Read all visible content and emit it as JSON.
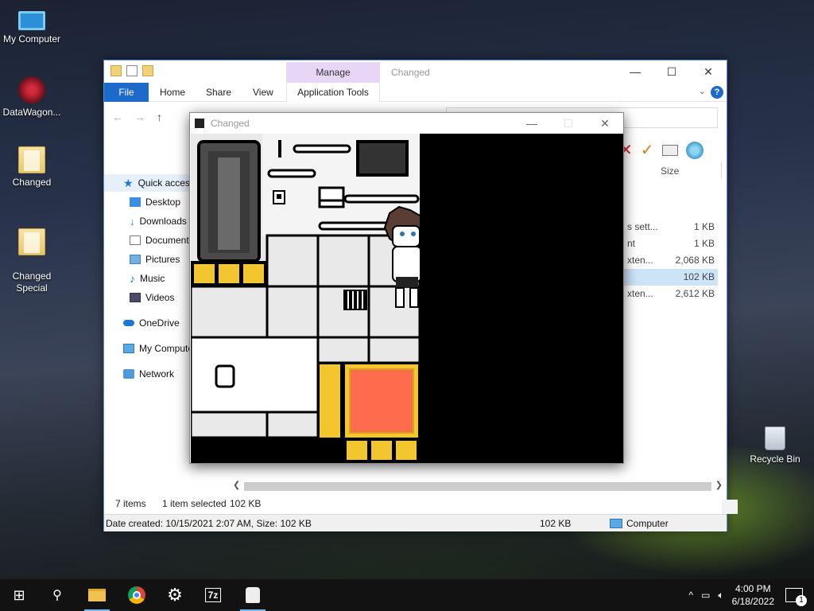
{
  "desktop": {
    "icons": [
      {
        "label": "My Computer",
        "icon": "computer-icon"
      },
      {
        "label": "DataWagon...",
        "icon": "datawagon-icon"
      },
      {
        "label": "Changed",
        "icon": "folder-icon"
      },
      {
        "label": "Changed\nSpecial",
        "icon": "folder-icon"
      },
      {
        "label": "Recycle Bin",
        "icon": "recycle-bin-icon"
      }
    ]
  },
  "explorer": {
    "title": "Changed",
    "manage_tab": "Manage",
    "ribbon_tabs": [
      "File",
      "Home",
      "Share",
      "View",
      "Application Tools"
    ],
    "nav_items": [
      {
        "label": "Quick access",
        "icon": "star-icon"
      },
      {
        "label": "Desktop",
        "icon": "desktop-icon"
      },
      {
        "label": "Downloads",
        "icon": "download-icon"
      },
      {
        "label": "Documents",
        "icon": "documents-icon"
      },
      {
        "label": "Pictures",
        "icon": "pictures-icon"
      },
      {
        "label": "Music",
        "icon": "music-icon"
      },
      {
        "label": "Videos",
        "icon": "videos-icon"
      },
      {
        "label": "OneDrive",
        "icon": "onedrive-icon"
      },
      {
        "label": "My Computer",
        "icon": "computer-icon"
      },
      {
        "label": "Network",
        "icon": "network-icon"
      }
    ],
    "column_header": "Size",
    "files": [
      {
        "name": "s sett...",
        "size": "1 KB",
        "selected": false
      },
      {
        "name": "nt",
        "size": "1 KB",
        "selected": false
      },
      {
        "name": "xten...",
        "size": "2,068 KB",
        "selected": false
      },
      {
        "name": "",
        "size": "102 KB",
        "selected": true
      },
      {
        "name": "xten...",
        "size": "2,612 KB",
        "selected": false
      }
    ],
    "status": {
      "items": "7 items",
      "selected": "1 item selected",
      "selected_size": "102 KB"
    },
    "details_bar": {
      "info": "Date created: 10/15/2021 2:07 AM, Size: 102 KB",
      "size": "102 KB",
      "location": "Computer"
    }
  },
  "game": {
    "title": "Changed"
  },
  "taskbar": {
    "apps": [
      "start-icon",
      "search-icon",
      "file-explorer-icon",
      "chrome-icon",
      "settings-icon",
      "7zip-icon",
      "changed-game-icon"
    ],
    "time": "4:00 PM",
    "date": "6/18/2022",
    "notification_count": "1"
  },
  "colors": {
    "accent": "#1c6ac9",
    "manage_tab": "#e7d6f5",
    "selection": "#cce4f7",
    "hazard_yellow": "#f2c62f",
    "red_square": "#ff6b4d"
  }
}
